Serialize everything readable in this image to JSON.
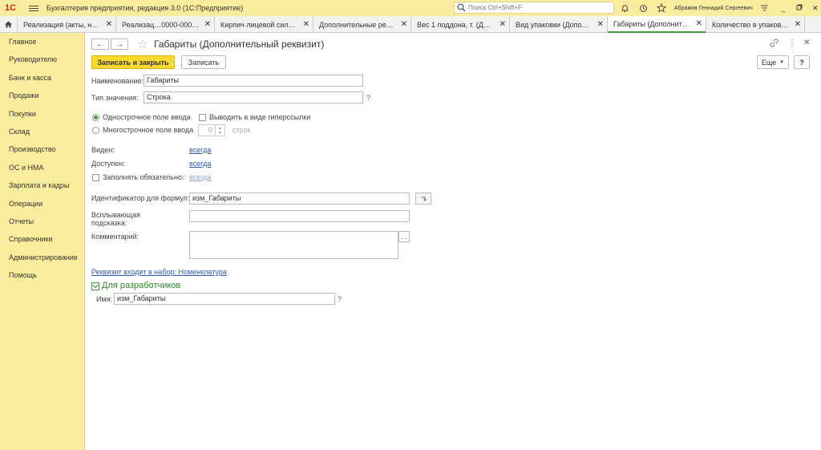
{
  "app": {
    "logo": "1С",
    "title": "Бухгалтерия предприятия, редакция 3.0  (1С:Предприятие)",
    "search_placeholder": "Поиск Ctrl+Shift+F",
    "user": "Абрамов Геннадий Сергеевич"
  },
  "tabs": [
    {
      "label": "Реализация (акты, на…",
      "active": false
    },
    {
      "label": "Реализац…0000-000602",
      "active": false
    },
    {
      "label": "Кирпич лицевой сили…",
      "active": false
    },
    {
      "label": "Дополнительные рекв…",
      "active": false
    },
    {
      "label": "Вес 1 поддона, т. (До…",
      "active": false
    },
    {
      "label": "Вид упаковки (Дополн…",
      "active": false
    },
    {
      "label": "Габариты (Дополните…",
      "active": true
    },
    {
      "label": "Количество в упаковк…",
      "active": false
    }
  ],
  "sidebar": {
    "items": [
      {
        "label": "Главное"
      },
      {
        "label": "Руководителю"
      },
      {
        "label": "Банк и касса"
      },
      {
        "label": "Продажи"
      },
      {
        "label": "Покупки"
      },
      {
        "label": "Склад"
      },
      {
        "label": "Производство"
      },
      {
        "label": "ОС и НМА"
      },
      {
        "label": "Зарплата и кадры"
      },
      {
        "label": "Операции"
      },
      {
        "label": "Отчеты"
      },
      {
        "label": "Справочники"
      },
      {
        "label": "Администрирование"
      },
      {
        "label": "Помощь"
      }
    ]
  },
  "form": {
    "title": "Габариты (Дополнительный реквизит)",
    "save_close_label": "Записать и закрыть",
    "save_label": "Записать",
    "more_label": "Еще",
    "help_label": "?",
    "name_label": "Наименование:",
    "name_value": "Габариты",
    "type_label": "Тип значения:",
    "type_value": "Строка",
    "single_line_label": "Однострочное поле ввода",
    "hyperlink_label": "Выводить в виде гиперссылки",
    "multi_line_label": "Многострочное поле ввода",
    "lines_value": "0",
    "lines_unit": "строк",
    "visible_label": "Виден:",
    "visible_value": "всегда",
    "available_label": "Доступен:",
    "available_value": "всегда",
    "required_label": "Заполнять обязательно:",
    "required_value": "всегда",
    "formula_id_label": "Идентификатор для формул:",
    "formula_id_value": "изм_Габариты",
    "tooltip_label": "Всплывающая подсказка:",
    "tooltip_value": "",
    "comment_label": "Комментарий:",
    "comment_value": "",
    "set_link": "Реквизит входит в набор: Номенклатура",
    "dev_group_label": "Для разработчиков",
    "dev_name_label": "Имя:",
    "dev_name_value": "изм_Габариты"
  },
  "colors": {
    "sidebar_bg": "#fbed9e",
    "primary_button": "#fbd92e",
    "accent_green": "#4a9b3f",
    "link_blue": "#2b5ab0"
  }
}
